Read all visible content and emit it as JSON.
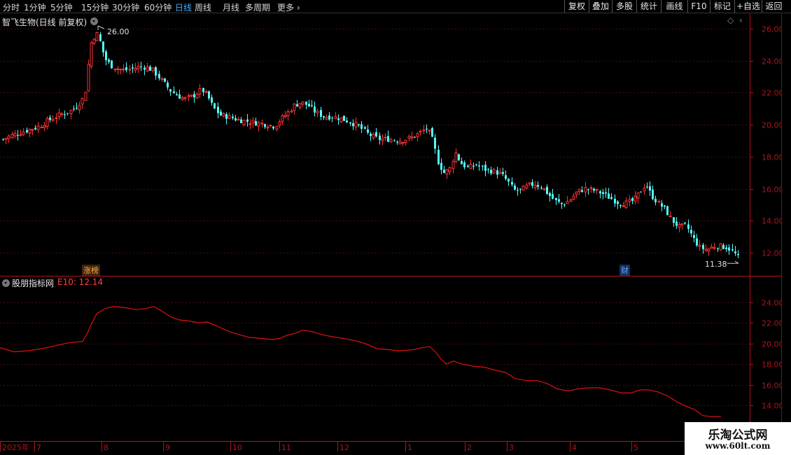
{
  "toolbar": {
    "periods": [
      "分时",
      "1分钟",
      "5分钟",
      "15分钟",
      "30分钟",
      "60分钟",
      "日线",
      "周线",
      "月线",
      "多周期"
    ],
    "active_period": "日线",
    "more": "更多",
    "buttons": [
      "复权",
      "叠加",
      "多股",
      "统计",
      "画线",
      "F10",
      "标记",
      "+自选",
      "返回"
    ]
  },
  "main_panel": {
    "title": "智飞生物(日线 前复权)",
    "high_marker": "26.00",
    "low_marker": "11.38",
    "event_tags": [
      "涨榜",
      "财"
    ]
  },
  "indicator_panel": {
    "title": "股朋指标网",
    "series_label": "E10: 12.14"
  },
  "colors": {
    "up": "#ff3232",
    "down": "#54fcfc",
    "ma_line": "#e01010",
    "axis": "#b0131b",
    "grid": "#4a0d10",
    "active_tab": "#4aa8ff"
  },
  "watermark": {
    "line1": "乐淘公式网",
    "line2": "www.60lt.com"
  },
  "chart_data": [
    {
      "type": "candlestick",
      "ylim": [
        10.5,
        27.0
      ],
      "yticks": [
        "26.00",
        "24.00",
        "22.00",
        "20.00",
        "18.00",
        "16.00",
        "14.00",
        "12.00"
      ],
      "x_labels": [
        "2025年",
        "7",
        "8",
        "9",
        "10",
        "11",
        "12",
        "1",
        "2",
        "3",
        "4",
        "5"
      ],
      "close_path": [
        [
          0,
          19.0
        ],
        [
          14,
          19.3
        ],
        [
          28,
          19.5
        ],
        [
          42,
          19.7
        ],
        [
          56,
          19.9
        ],
        [
          70,
          20.3
        ],
        [
          84,
          20.6
        ],
        [
          98,
          20.8
        ],
        [
          108,
          21.1
        ],
        [
          118,
          21.6
        ],
        [
          124,
          22.5
        ],
        [
          127,
          24.6
        ],
        [
          131,
          25.3
        ],
        [
          136,
          25.6
        ],
        [
          140,
          25.7
        ],
        [
          144,
          24.9
        ],
        [
          150,
          24.1
        ],
        [
          158,
          23.7
        ],
        [
          168,
          23.5
        ],
        [
          178,
          23.4
        ],
        [
          188,
          23.5
        ],
        [
          198,
          23.6
        ],
        [
          208,
          23.6
        ],
        [
          218,
          23.4
        ],
        [
          226,
          23.0
        ],
        [
          234,
          22.6
        ],
        [
          244,
          22.1
        ],
        [
          254,
          21.8
        ],
        [
          264,
          21.6
        ],
        [
          276,
          21.8
        ],
        [
          288,
          22.2
        ],
        [
          296,
          21.8
        ],
        [
          304,
          21.1
        ],
        [
          314,
          20.6
        ],
        [
          326,
          20.5
        ],
        [
          340,
          20.3
        ],
        [
          354,
          20.2
        ],
        [
          368,
          20.1
        ],
        [
          382,
          20.0
        ],
        [
          392,
          19.9
        ],
        [
          400,
          20.3
        ],
        [
          410,
          20.7
        ],
        [
          420,
          21.2
        ],
        [
          430,
          21.4
        ],
        [
          440,
          21.2
        ],
        [
          450,
          20.8
        ],
        [
          462,
          20.5
        ],
        [
          474,
          20.5
        ],
        [
          486,
          20.4
        ],
        [
          498,
          20.2
        ],
        [
          512,
          19.9
        ],
        [
          526,
          19.4
        ],
        [
          540,
          19.1
        ],
        [
          556,
          19.1
        ],
        [
          572,
          19.0
        ],
        [
          588,
          19.2
        ],
        [
          600,
          19.5
        ],
        [
          610,
          19.8
        ],
        [
          618,
          19.0
        ],
        [
          626,
          17.6
        ],
        [
          634,
          17.0
        ],
        [
          642,
          17.2
        ],
        [
          650,
          18.3
        ],
        [
          658,
          17.6
        ],
        [
          668,
          17.3
        ],
        [
          680,
          17.5
        ],
        [
          692,
          17.2
        ],
        [
          704,
          17.1
        ],
        [
          716,
          16.9
        ],
        [
          726,
          16.4
        ],
        [
          734,
          15.9
        ],
        [
          744,
          15.9
        ],
        [
          754,
          16.2
        ],
        [
          764,
          16.3
        ],
        [
          774,
          16.1
        ],
        [
          784,
          15.6
        ],
        [
          794,
          15.2
        ],
        [
          804,
          15.0
        ],
        [
          814,
          15.3
        ],
        [
          824,
          15.8
        ],
        [
          836,
          16.0
        ],
        [
          848,
          15.9
        ],
        [
          860,
          15.7
        ],
        [
          872,
          15.4
        ],
        [
          884,
          15.1
        ],
        [
          896,
          15.1
        ],
        [
          906,
          15.3
        ],
        [
          914,
          15.8
        ],
        [
          922,
          16.3
        ],
        [
          930,
          15.6
        ],
        [
          940,
          15.1
        ],
        [
          950,
          14.7
        ],
        [
          960,
          14.0
        ],
        [
          970,
          13.6
        ],
        [
          980,
          13.7
        ],
        [
          990,
          12.9
        ],
        [
          1000,
          12.3
        ],
        [
          1010,
          12.2
        ],
        [
          1020,
          12.4
        ],
        [
          1030,
          12.4
        ],
        [
          1040,
          12.3
        ],
        [
          1050,
          11.9
        ],
        [
          1058,
          11.5
        ]
      ]
    },
    {
      "type": "line",
      "name": "E10",
      "ylim": [
        12.8,
        26.3
      ],
      "yticks": [
        "24.00",
        "22.00",
        "20.00",
        "18.00",
        "16.00",
        "14.00"
      ],
      "values": [
        [
          0,
          19.6
        ],
        [
          20,
          19.2
        ],
        [
          40,
          19.3
        ],
        [
          60,
          19.5
        ],
        [
          80,
          19.8
        ],
        [
          100,
          20.1
        ],
        [
          118,
          20.2
        ],
        [
          124,
          20.9
        ],
        [
          130,
          21.8
        ],
        [
          138,
          22.9
        ],
        [
          150,
          23.4
        ],
        [
          162,
          23.6
        ],
        [
          178,
          23.5
        ],
        [
          194,
          23.3
        ],
        [
          208,
          23.4
        ],
        [
          220,
          23.6
        ],
        [
          230,
          23.2
        ],
        [
          244,
          22.6
        ],
        [
          256,
          22.3
        ],
        [
          270,
          22.2
        ],
        [
          284,
          22.0
        ],
        [
          296,
          22.1
        ],
        [
          310,
          21.7
        ],
        [
          326,
          21.2
        ],
        [
          340,
          20.9
        ],
        [
          356,
          20.6
        ],
        [
          372,
          20.5
        ],
        [
          388,
          20.4
        ],
        [
          400,
          20.5
        ],
        [
          410,
          20.8
        ],
        [
          422,
          21.0
        ],
        [
          432,
          21.3
        ],
        [
          444,
          21.2
        ],
        [
          458,
          20.9
        ],
        [
          472,
          20.7
        ],
        [
          490,
          20.5
        ],
        [
          506,
          20.3
        ],
        [
          522,
          20.0
        ],
        [
          538,
          19.5
        ],
        [
          556,
          19.4
        ],
        [
          572,
          19.3
        ],
        [
          590,
          19.4
        ],
        [
          604,
          19.6
        ],
        [
          614,
          19.7
        ],
        [
          622,
          19.2
        ],
        [
          630,
          18.5
        ],
        [
          638,
          18.0
        ],
        [
          648,
          18.3
        ],
        [
          660,
          18.0
        ],
        [
          676,
          17.8
        ],
        [
          692,
          17.7
        ],
        [
          708,
          17.4
        ],
        [
          722,
          17.2
        ],
        [
          736,
          16.6
        ],
        [
          752,
          16.4
        ],
        [
          768,
          16.4
        ],
        [
          782,
          16.1
        ],
        [
          796,
          15.6
        ],
        [
          812,
          15.4
        ],
        [
          826,
          15.6
        ],
        [
          840,
          15.7
        ],
        [
          856,
          15.7
        ],
        [
          872,
          15.5
        ],
        [
          888,
          15.2
        ],
        [
          902,
          15.2
        ],
        [
          914,
          15.5
        ],
        [
          926,
          15.5
        ],
        [
          940,
          15.3
        ],
        [
          954,
          14.9
        ],
        [
          968,
          14.3
        ],
        [
          980,
          13.9
        ],
        [
          992,
          13.6
        ],
        [
          1004,
          13.0
        ],
        [
          1016,
          12.9
        ],
        [
          1030,
          12.9
        ]
      ]
    }
  ]
}
